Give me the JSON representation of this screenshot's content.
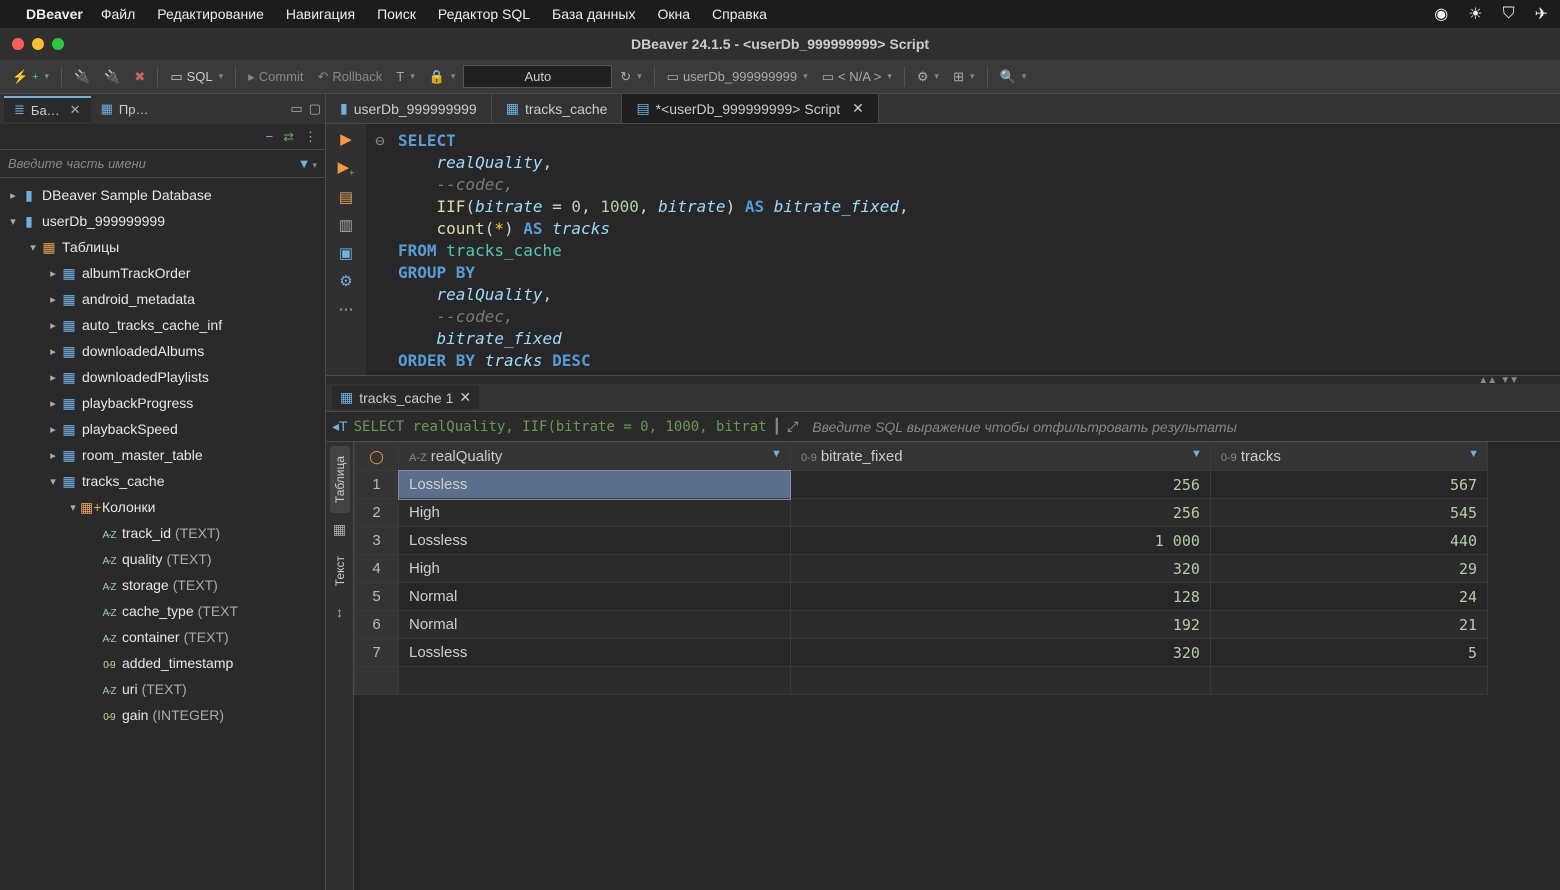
{
  "mac_menu": {
    "app": "DBeaver",
    "items": [
      "Файл",
      "Редактирование",
      "Навигация",
      "Поиск",
      "Редактор SQL",
      "База данных",
      "Окна",
      "Справка"
    ]
  },
  "window_title": "DBeaver 24.1.5 - <userDb_999999999> Script",
  "toolbar": {
    "sql": "SQL",
    "commit": "Commit",
    "rollback": "Rollback",
    "auto": "Auto",
    "conn": "userDb_999999999",
    "schema": "< N/A >"
  },
  "sidebar": {
    "tabs": [
      {
        "label": "Ба…",
        "active": true
      },
      {
        "label": "Пр…",
        "active": false
      }
    ],
    "filter_placeholder": "Введите часть имени",
    "tree": [
      {
        "level": 0,
        "arrow": ">",
        "icon": "db",
        "label": "DBeaver Sample Database"
      },
      {
        "level": 0,
        "arrow": "v",
        "icon": "db",
        "label": "userDb_999999999"
      },
      {
        "level": 1,
        "arrow": "v",
        "icon": "folder",
        "label": "Таблицы"
      },
      {
        "level": 2,
        "arrow": ">",
        "icon": "table",
        "label": "albumTrackOrder"
      },
      {
        "level": 2,
        "arrow": ">",
        "icon": "table",
        "label": "android_metadata"
      },
      {
        "level": 2,
        "arrow": ">",
        "icon": "table",
        "label": "auto_tracks_cache_inf"
      },
      {
        "level": 2,
        "arrow": ">",
        "icon": "table",
        "label": "downloadedAlbums"
      },
      {
        "level": 2,
        "arrow": ">",
        "icon": "table",
        "label": "downloadedPlaylists"
      },
      {
        "level": 2,
        "arrow": ">",
        "icon": "table",
        "label": "playbackProgress"
      },
      {
        "level": 2,
        "arrow": ">",
        "icon": "table",
        "label": "playbackSpeed"
      },
      {
        "level": 2,
        "arrow": ">",
        "icon": "table",
        "label": "room_master_table"
      },
      {
        "level": 2,
        "arrow": "v",
        "icon": "table",
        "label": "tracks_cache"
      },
      {
        "level": 3,
        "arrow": "v",
        "icon": "cols",
        "label": "Колонки"
      },
      {
        "level": 4,
        "arrow": "",
        "icon": "col-az",
        "label": "track_id",
        "type": "(TEXT)"
      },
      {
        "level": 4,
        "arrow": "",
        "icon": "col-az",
        "label": "quality",
        "type": "(TEXT)"
      },
      {
        "level": 4,
        "arrow": "",
        "icon": "col-az",
        "label": "storage",
        "type": "(TEXT)"
      },
      {
        "level": 4,
        "arrow": "",
        "icon": "col-az",
        "label": "cache_type",
        "type": "(TEXT"
      },
      {
        "level": 4,
        "arrow": "",
        "icon": "col-az",
        "label": "container",
        "type": "(TEXT)"
      },
      {
        "level": 4,
        "arrow": "",
        "icon": "col-09",
        "label": "added_timestamp",
        "type": ""
      },
      {
        "level": 4,
        "arrow": "",
        "icon": "col-az",
        "label": "uri",
        "type": "(TEXT)"
      },
      {
        "level": 4,
        "arrow": "",
        "icon": "col-09",
        "label": "gain",
        "type": "(INTEGER)"
      }
    ]
  },
  "editor_tabs": [
    {
      "label": "userDb_999999999",
      "icon": "db",
      "active": false,
      "close": false
    },
    {
      "label": "tracks_cache",
      "icon": "table",
      "active": false,
      "close": false
    },
    {
      "label": "*<userDb_999999999> Script",
      "icon": "script",
      "active": true,
      "close": true
    }
  ],
  "sql": [
    {
      "indent": 0,
      "tokens": [
        [
          "kw",
          "SELECT"
        ]
      ]
    },
    {
      "indent": 1,
      "tokens": [
        [
          "id",
          "realQuality"
        ],
        [
          "op",
          ","
        ]
      ]
    },
    {
      "indent": 1,
      "tokens": [
        [
          "cm",
          "--codec,"
        ]
      ]
    },
    {
      "indent": 1,
      "tokens": [
        [
          "fn",
          "IIF"
        ],
        [
          "op",
          "("
        ],
        [
          "id",
          "bitrate"
        ],
        [
          "op",
          " = "
        ],
        [
          "num",
          "0"
        ],
        [
          "op",
          ", "
        ],
        [
          "num",
          "1000"
        ],
        [
          "op",
          ", "
        ],
        [
          "id",
          "bitrate"
        ],
        [
          "op",
          ") "
        ],
        [
          "kw",
          "AS"
        ],
        [
          "op",
          " "
        ],
        [
          "id",
          "bitrate_fixed"
        ],
        [
          "op",
          ","
        ]
      ]
    },
    {
      "indent": 1,
      "tokens": [
        [
          "fn",
          "count"
        ],
        [
          "op",
          "("
        ],
        [
          "star",
          "*"
        ],
        [
          "op",
          ") "
        ],
        [
          "kw",
          "AS"
        ],
        [
          "op",
          " "
        ],
        [
          "id",
          "tracks"
        ]
      ]
    },
    {
      "indent": 0,
      "tokens": [
        [
          "kw",
          "FROM"
        ],
        [
          "op",
          " "
        ],
        [
          "tbl",
          "tracks_cache"
        ]
      ]
    },
    {
      "indent": 0,
      "tokens": [
        [
          "kw",
          "GROUP BY"
        ]
      ]
    },
    {
      "indent": 1,
      "tokens": [
        [
          "id",
          "realQuality"
        ],
        [
          "op",
          ","
        ]
      ]
    },
    {
      "indent": 1,
      "tokens": [
        [
          "cm",
          "--codec,"
        ]
      ]
    },
    {
      "indent": 1,
      "tokens": [
        [
          "id",
          "bitrate_fixed"
        ]
      ]
    },
    {
      "indent": 0,
      "tokens": [
        [
          "kw",
          "ORDER BY"
        ],
        [
          "op",
          " "
        ],
        [
          "id",
          "tracks"
        ],
        [
          "op",
          " "
        ],
        [
          "kw",
          "DESC"
        ]
      ]
    }
  ],
  "results": {
    "tab": "tracks_cache 1",
    "query_snippet": "SELECT realQuality, IIF(bitrate = 0, 1000, bitrat",
    "filter_placeholder": "Введите SQL выражение чтобы отфильтровать результаты",
    "vtabs": [
      "Таблица",
      "Текст"
    ],
    "columns": [
      {
        "prefix": "A-Z",
        "name": "realQuality"
      },
      {
        "prefix": "0-9",
        "name": "bitrate_fixed"
      },
      {
        "prefix": "0-9",
        "name": "tracks"
      }
    ],
    "rows": [
      {
        "n": "1",
        "cells": [
          "Lossless",
          "256",
          "567"
        ],
        "sel": 0
      },
      {
        "n": "2",
        "cells": [
          "High",
          "256",
          "545"
        ]
      },
      {
        "n": "3",
        "cells": [
          "Lossless",
          "1 000",
          "440"
        ]
      },
      {
        "n": "4",
        "cells": [
          "High",
          "320",
          "29"
        ]
      },
      {
        "n": "5",
        "cells": [
          "Normal",
          "128",
          "24"
        ]
      },
      {
        "n": "6",
        "cells": [
          "Normal",
          "192",
          "21"
        ]
      },
      {
        "n": "7",
        "cells": [
          "Lossless",
          "320",
          "5"
        ]
      }
    ]
  }
}
